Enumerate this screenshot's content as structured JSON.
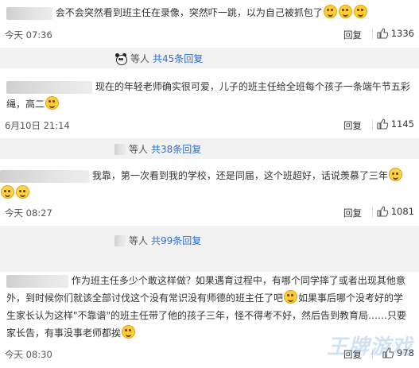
{
  "comments": [
    {
      "text": "会不会突然看到班主任在录像，突然吓一跳，以为自己被抓包了",
      "time": "今天 07:36",
      "reply": "回复",
      "likes": "1336"
    },
    {
      "text": "现在的年轻老师确实很可爱，儿子的班主任给全班每个孩子一条端午节五彩绳，高二",
      "time": "6月10日 21:14",
      "reply": "回复",
      "likes": "1145"
    },
    {
      "text": "我靠，第一次看到我的学校，还是同届，这个班超好，话说羡慕了三年",
      "time": "今天 08:27",
      "reply": "回复",
      "likes": "1081"
    },
    {
      "text_1": "作为班主任多少个敢这样做？如果遇育过程中，有哪个同学摔了或者出现其他意外，到时候你们就该全部讨伐这个没有常识没有师德的班主任了吧",
      "text_2": "如果事后哪个没考好的学生家长认为这样\"不靠谱\"的班主任带了他的孩子三年，怪不得考不好，然后告到教育局……只要家长告，有事没事老师都挨",
      "time": "今天 08:30",
      "reply": "回复",
      "likes": "978"
    }
  ],
  "subbars": [
    {
      "etc": "等人",
      "more": "共45条回复"
    },
    {
      "etc": "等人",
      "more": "共38条回复"
    },
    {
      "etc": "等人",
      "more": "共99条回复"
    }
  ],
  "watermark": "王牌游戏"
}
